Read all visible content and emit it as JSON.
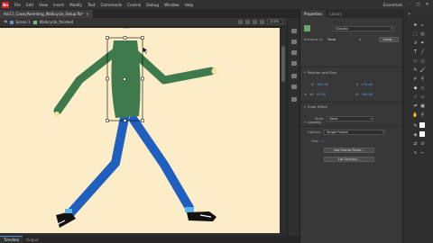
{
  "menubar": {
    "logo": "An",
    "items": [
      "File",
      "Edit",
      "View",
      "Insert",
      "Modify",
      "Text",
      "Commands",
      "Control",
      "Debug",
      "Window",
      "Help"
    ],
    "workspace": "Essentials"
  },
  "document": {
    "tab_title": "Ani11_CaseyParenting_Walkcycle_Setup.fla*",
    "scene": "Scene 1",
    "symbol": "Walkcycle_finished",
    "zoom": "223%"
  },
  "properties": {
    "tabs": [
      "Properties",
      "Library"
    ],
    "instance_type": "Graphic",
    "instance_of_label": "Instance of:",
    "instance_of_value": "Torso",
    "swap_label": "Swap...",
    "position_section": "Position and Size",
    "x_label": "X:",
    "x_value": "302.05",
    "y_label": "Y:",
    "y_value": "135.60",
    "w_label": "W:",
    "w_value": "82.90",
    "h_label": "H:",
    "h_value": "164.80",
    "color_section": "Color Effect",
    "style_label": "Style:",
    "style_value": "None",
    "looping_section": "Looping",
    "options_label": "Options:",
    "options_value": "Single Frame",
    "first_label": "First:",
    "first_value": "1",
    "frame_picker_label": "Use Frame Picker...",
    "lip_sync_label": "Lip Syncing..."
  },
  "bottom_tabs": [
    "Timeline",
    "Output"
  ],
  "colors": {
    "stage": "#fcedc8",
    "shirt": "#3f7a4d",
    "pants": "#1f5fbf",
    "skin": "#f4e3a3",
    "accent": "#4ea3f5"
  }
}
